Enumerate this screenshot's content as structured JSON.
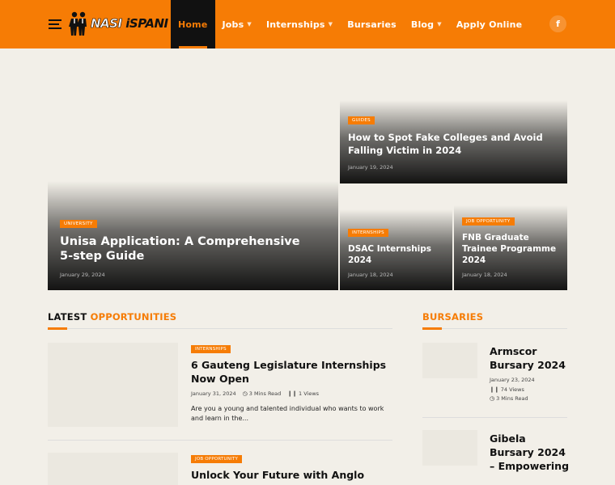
{
  "header": {
    "logo": {
      "word1": "NASI",
      "word2": "iSPANI"
    },
    "nav": [
      {
        "label": "Home",
        "dropdown": false,
        "active": true
      },
      {
        "label": "Jobs",
        "dropdown": true,
        "active": false
      },
      {
        "label": "Internships",
        "dropdown": true,
        "active": false
      },
      {
        "label": "Bursaries",
        "dropdown": false,
        "active": false
      },
      {
        "label": "Blog",
        "dropdown": true,
        "active": false
      },
      {
        "label": "Apply Online",
        "dropdown": false,
        "active": false
      }
    ],
    "social": {
      "facebook": "f"
    }
  },
  "featured": {
    "main": {
      "category": "UNIVERSITY",
      "title": "Unisa Application: A Comprehensive 5-step Guide",
      "date": "January 29, 2024"
    },
    "top_right": {
      "category": "GUIDES",
      "title": "How to Spot Fake Colleges and Avoid Falling Victim in 2024",
      "date": "January 19, 2024"
    },
    "bottom_left": {
      "category": "INTERNSHIPS",
      "title": "DSAC Internships 2024",
      "date": "January 18, 2024"
    },
    "bottom_right": {
      "category": "JOB OPPORTUNITY",
      "title": "FNB Graduate Trainee Programme 2024",
      "date": "January 18, 2024"
    }
  },
  "latest": {
    "heading_dark": "LATEST",
    "heading_orange": "OPPORTUNITIES",
    "posts": [
      {
        "category": "INTERNSHIPS",
        "title": "6 Gauteng Legislature Internships Now Open",
        "date": "January 31, 2024",
        "read_time": "3 Mins Read",
        "views": "1 Views",
        "excerpt": "Are you a young and talented individual who wants to work and learn in the..."
      },
      {
        "category": "JOB OPPORTUNITY",
        "title": "Unlock Your Future with Anglo"
      }
    ]
  },
  "bursaries": {
    "heading": "BURSARIES",
    "posts": [
      {
        "title": "Armscor Bursary 2024",
        "date": "January 23, 2024",
        "views": "74 Views",
        "read_time": "3 Mins Read"
      },
      {
        "title": "Gibela Bursary 2024 – Empowering"
      }
    ]
  },
  "colors": {
    "accent": "#f67c05",
    "header_bg": "#f67c05",
    "page_bg": "#f2efe8",
    "nav_active_bg": "#111111"
  }
}
